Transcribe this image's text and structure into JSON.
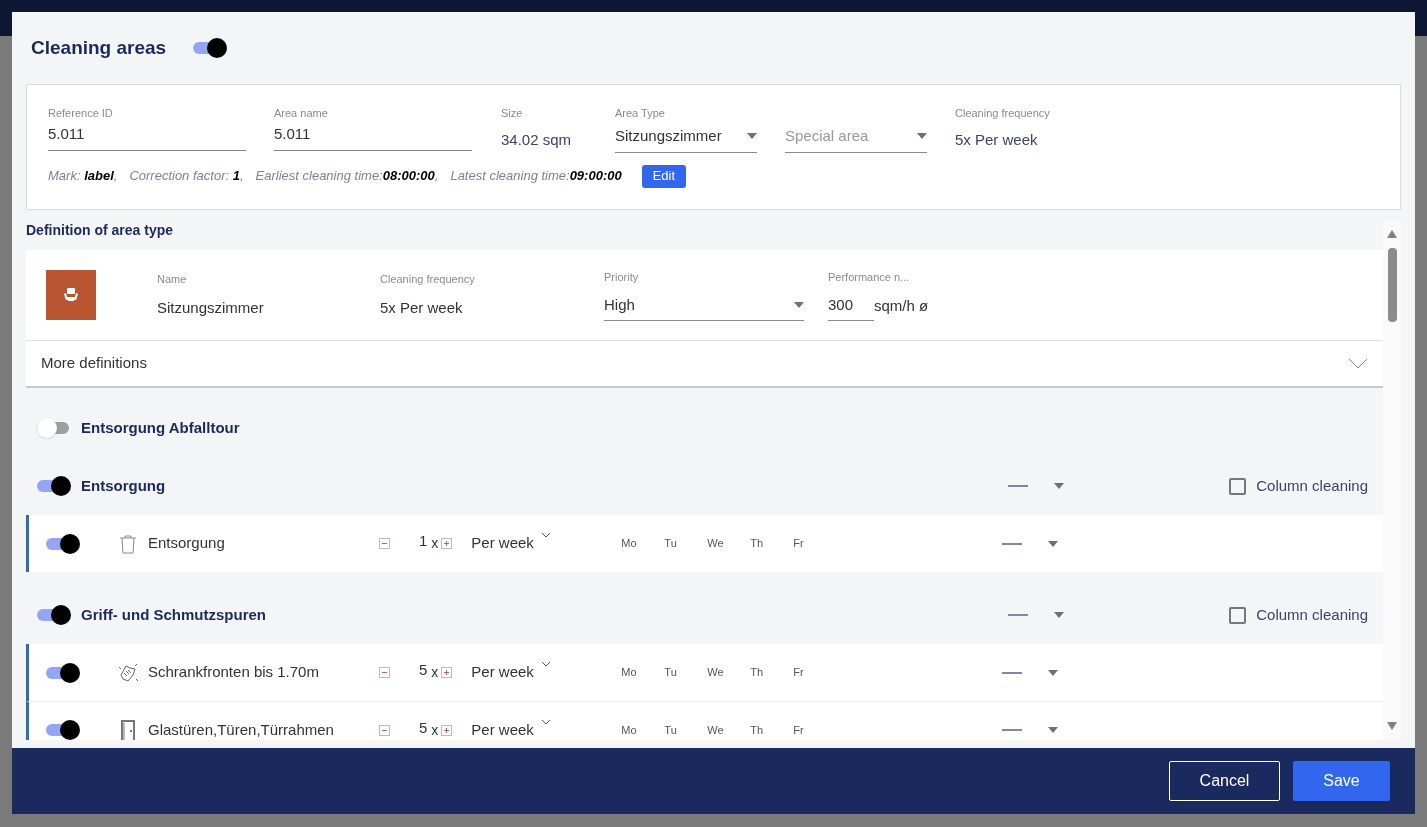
{
  "dialog": {
    "title": "Cleaning areas",
    "enabled": true
  },
  "details": {
    "fields": [
      {
        "kind": "input",
        "label": "Reference ID",
        "value": "5.011"
      },
      {
        "kind": "input",
        "label": "Area name",
        "value": "5.011"
      },
      {
        "kind": "static",
        "label": "Size",
        "value": "34.02 sqm"
      },
      {
        "kind": "select",
        "label": "Area Type",
        "value": "Sitzungszimmer"
      },
      {
        "kind": "select",
        "placeholder": "Special area"
      },
      {
        "kind": "static",
        "label": "Cleaning frequency",
        "value": "5x Per week"
      }
    ],
    "info": [
      "Mark: **label**,",
      "Correction factor: **1**,",
      "Earliest cleaning time:**08:00:00**,",
      "Latest cleaning time:**09:00:00**"
    ],
    "edit_button": "Edit"
  },
  "definition": {
    "title": "Definition of area type",
    "name_label": "Name",
    "name": "Sitzungszimmer",
    "frequency_label": "Cleaning frequency",
    "frequency": "5x Per week",
    "priority_label": "Priority",
    "priority": "High",
    "performance_label": "Performance n...",
    "performance": "300",
    "performance_unit": "sqm/h ø",
    "more": "More definitions",
    "more_expanded": false
  },
  "groups": [
    {
      "title": "Entsorgung Abfalltour",
      "on": false
    },
    {
      "title": "Entsorgung",
      "on": true,
      "column_cleaning": {
        "label": "Column cleaning",
        "checked": false
      },
      "tasks": [
        {
          "on": true,
          "kind": "trash",
          "name": "Entsorgung",
          "count": "1",
          "times": "x",
          "period": "Per week",
          "days": [
            "Mo",
            "Tu",
            "We",
            "Th",
            "Fr"
          ]
        }
      ]
    },
    {
      "title": "Griff- und Schmutzspuren",
      "on": true,
      "column_cleaning": {
        "label": "Column cleaning",
        "checked": false
      },
      "tasks": [
        {
          "on": true,
          "kind": "wipe",
          "name": "Schrankfronten bis 1.70m",
          "count": "5",
          "times": "x",
          "period": "Per week",
          "days": [
            "Mo",
            "Tu",
            "We",
            "Th",
            "Fr"
          ]
        },
        {
          "on": true,
          "kind": "door",
          "name": "Glastüren,Türen,Türrahmen",
          "count": "5",
          "times": "x",
          "period": "Per week",
          "days": [
            "Mo",
            "Tu",
            "We",
            "Th",
            "Fr"
          ]
        }
      ]
    }
  ],
  "buttons": {
    "cancel": "Cancel",
    "save": "Save"
  }
}
